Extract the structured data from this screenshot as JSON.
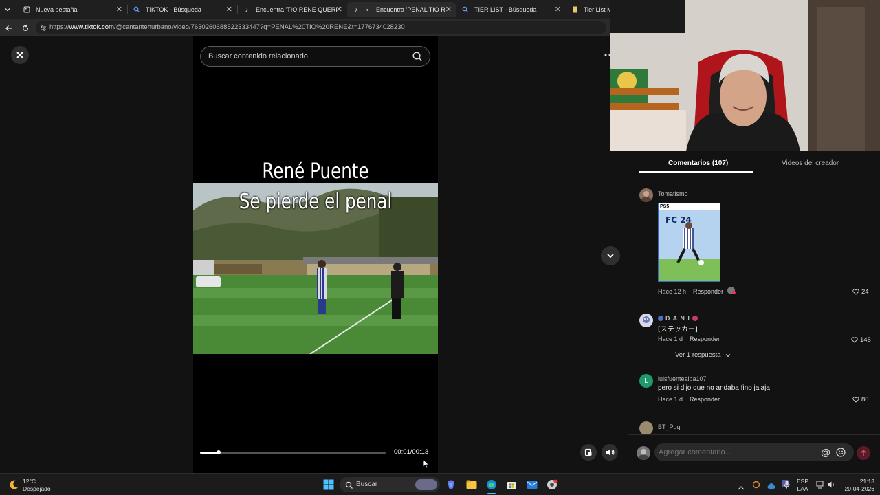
{
  "browser": {
    "tabs": [
      {
        "title": "Nueva pestaña",
        "icon": "new-tab-icon"
      },
      {
        "title": "TIKTOK - Búsqueda",
        "icon": "search-icon"
      },
      {
        "title": "Encuentra 'TIO RENE QUERI TO FU",
        "icon": "tiktok-icon"
      },
      {
        "title": "Encuentra 'PENAL TIO RENE'",
        "icon": "tiktok-icon"
      },
      {
        "title": "TIER LIST - Búsqueda",
        "icon": "search-icon"
      },
      {
        "title": "Tier List Mak",
        "icon": "doc-icon"
      }
    ],
    "url_prefix": "https://",
    "url_host": "www.tiktok.com",
    "url_rest": "/@cantantehurbano/video/7630260688522333447?q=PENAL%20TIO%20RENE&t=1776734028230"
  },
  "video": {
    "search_placeholder": "Buscar contenido relacionado",
    "caption_line1": "René Puente",
    "caption_line2": "Se pierde el penal",
    "time": "00:01/00:13",
    "progress": 0.1
  },
  "comments_panel": {
    "tab_comments": "Comentarios (107)",
    "tab_videos": "Videos del creador",
    "comments": [
      {
        "user": "Tomatismo",
        "text": "",
        "time": "Hace 12 h",
        "reply": "Responder",
        "likes": "24"
      },
      {
        "user": "D A N I",
        "text": "[ステッカー]",
        "time": "Hace 1 d",
        "reply": "Responder",
        "likes": "145"
      },
      {
        "user": "luisfuentealba107",
        "text": "pero si dijo que no andaba fino jajaja",
        "time": "Hace 1 d",
        "reply": "Responder",
        "likes": "80"
      },
      {
        "user": "BT_Puq",
        "text": "",
        "time": "",
        "reply": "",
        "likes": ""
      }
    ],
    "view_replies": "Ver 1 respuesta",
    "sticker": {
      "platform": "PS5",
      "game": "FC 24"
    },
    "avatar_letter": "L",
    "comment_placeholder": "Agregar comentario..."
  },
  "taskbar": {
    "weather_temp": "12°C",
    "weather_desc": "Despejado",
    "search_label": "Buscar",
    "lang_line1": "ESP",
    "lang_line2": "LAA",
    "clock_time": "21:13",
    "clock_date": "20-04-2026"
  },
  "colors": {
    "accent": "#fe2c55",
    "background": "#121212"
  }
}
